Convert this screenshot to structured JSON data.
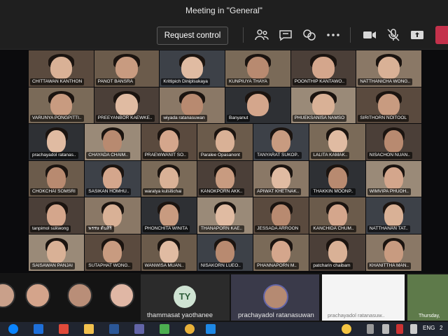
{
  "window": {
    "title": "Meeting in \"General\""
  },
  "toolbar": {
    "request_control_label": "Request control"
  },
  "participants": [
    "CHITTAWAN KANTHON",
    "PANOT BANSRA",
    "Krittipich Diniplsukaya",
    "KUNPIUYA THAYA",
    "POONTHIP KANTAWO..",
    "NATTHANICHA WONG..",
    "VARUNYA PONGPITTI..",
    "PREEYANBOR KAEWKE..",
    "wiyada ratanasuwan",
    "Banyanut",
    "PHUEKSANISA NAMSO",
    "SIRITHORN NOITOOL",
    "prachayadol ratanas..",
    "CHAYADA CHAIM..",
    "PRAEWWANIT SO..",
    "Paralee Opasanont",
    "TANYARAT SUKOP..",
    "LALITA KAMAK..",
    "NISACHON NUAN..",
    "CHOKCHAI SOMSRI",
    "SASIKAN HOMHU..",
    "waratya kulsitichai",
    "KANOKPORN AKK..",
    "APIWAT KHETNAK..",
    "THAKKIN MOONP..",
    "WIMVIPA PHUOH..",
    "tanpimol sukwong",
    "พรรษ ตันสิริ",
    "PHONCHITA WINITA",
    "THANAPORN KAE..",
    "JESSADA ARROON",
    "KANCHIDA CHUM..",
    "NATTHANAN TAT..",
    "SAISAWAN PANJAI",
    "SUTAPHAT WONG..",
    "WANWISA MUAN..",
    "NISAKORN LUEO..",
    "PHANNAPORN M..",
    "patcharin chaibam",
    "KHANITTHA MAN.."
  ],
  "bottom": {
    "card1_initials": "TY",
    "card1_name": "thammasat yaothanee",
    "card2_name": "prachayadol ratanasuwan",
    "share_name": "prachayadol ratanasuw..",
    "date_text": "Thursday,"
  },
  "taskbar": {
    "lang": "ENG",
    "time": "2"
  }
}
